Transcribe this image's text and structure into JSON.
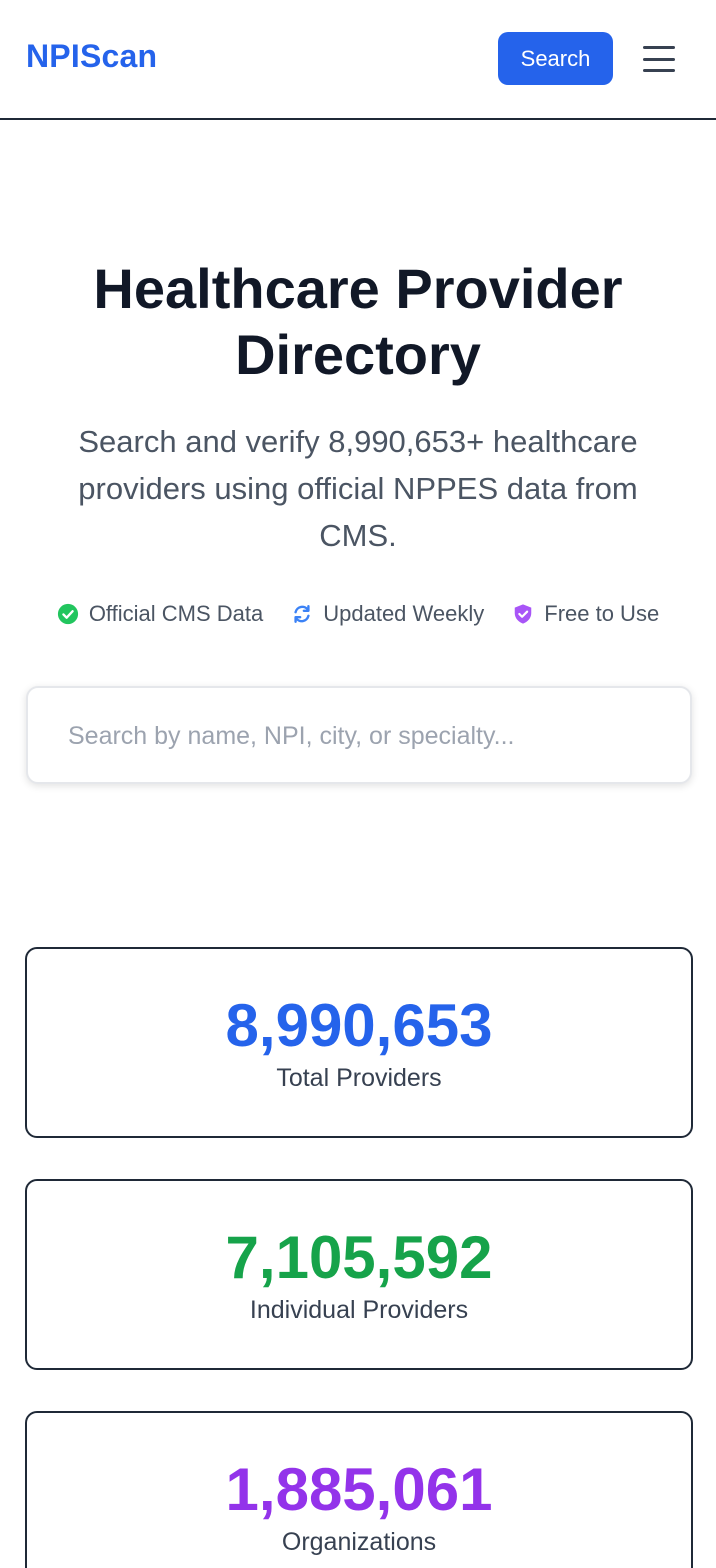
{
  "header": {
    "logo": "NPIScan",
    "search_button": "Search",
    "menu_icon": "hamburger-menu-icon"
  },
  "hero": {
    "title": "Healthcare Provider Directory",
    "subtitle": "Search and verify 8,990,653+ healthcare providers using official NPPES data from CMS."
  },
  "badges": [
    {
      "label": "Official CMS Data",
      "icon": "check-circle-icon",
      "color": "#22c55e"
    },
    {
      "label": "Updated Weekly",
      "icon": "refresh-icon",
      "color": "#3b82f6"
    },
    {
      "label": "Free to Use",
      "icon": "shield-check-icon",
      "color": "#a855f7"
    }
  ],
  "search": {
    "placeholder": "Search by name, NPI, city, or specialty...",
    "value": ""
  },
  "stats": [
    {
      "value": "8,990,653",
      "label": "Total Providers",
      "color": "#2563eb"
    },
    {
      "value": "7,105,592",
      "label": "Individual Providers",
      "color": "#16a34a"
    },
    {
      "value": "1,885,061",
      "label": "Organizations",
      "color": "#9333ea"
    }
  ],
  "colors": {
    "brand": "#2563eb",
    "text_dark": "#111827",
    "text_muted": "#4b5563"
  }
}
